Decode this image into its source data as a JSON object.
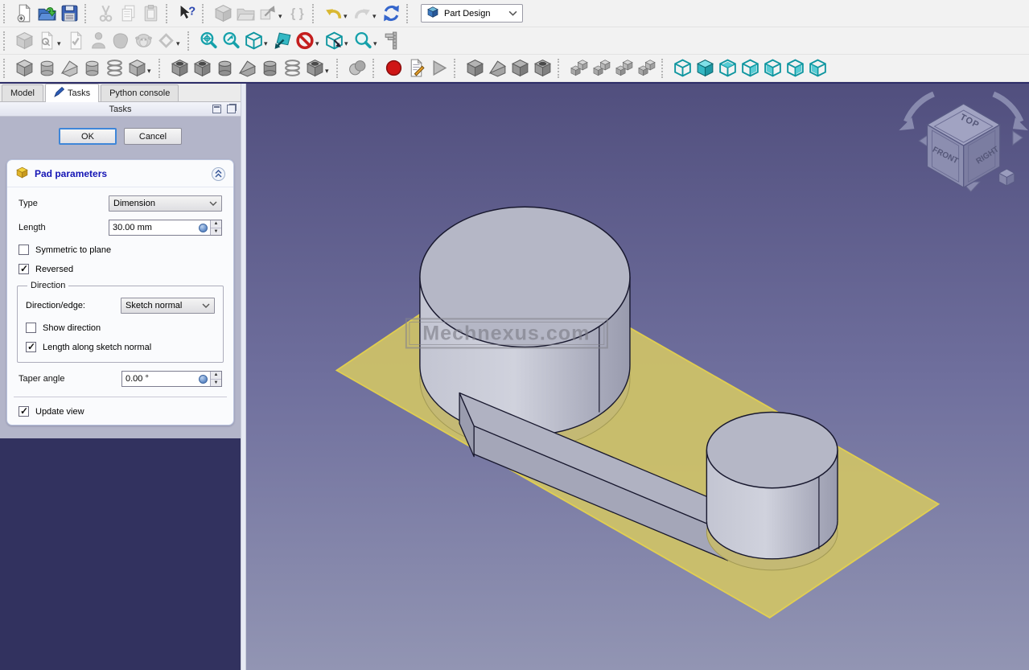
{
  "workbench_selector": {
    "value": "Part Design"
  },
  "toolbars": {
    "rows": [
      {
        "name": "row-1",
        "groups": [
          {
            "name": "file",
            "items": [
              {
                "name": "new-file",
                "icon": "page-new"
              },
              {
                "name": "open-file",
                "icon": "folder-open"
              },
              {
                "name": "save-file",
                "icon": "save"
              }
            ]
          },
          {
            "name": "edit",
            "items": [
              {
                "name": "cut",
                "icon": "cut",
                "disabled": true
              },
              {
                "name": "copy",
                "icon": "copy",
                "disabled": true
              },
              {
                "name": "paste",
                "icon": "paste",
                "disabled": true
              }
            ]
          },
          {
            "name": "help",
            "items": [
              {
                "name": "whats-this",
                "icon": "whats-this"
              }
            ]
          },
          {
            "name": "structure",
            "items": [
              {
                "name": "create-part",
                "icon": "part",
                "disabled": true
              },
              {
                "name": "create-group",
                "icon": "folder-gray",
                "disabled": true
              },
              {
                "name": "make-link",
                "icon": "link",
                "disabled": true,
                "dropdown": true
              },
              {
                "name": "create-variable-set",
                "icon": "braces",
                "disabled": true
              }
            ]
          },
          {
            "name": "undo-redo",
            "items": [
              {
                "name": "undo",
                "icon": "undo",
                "dropdown": true
              },
              {
                "name": "redo",
                "icon": "redo",
                "disabled": true,
                "dropdown": true
              },
              {
                "name": "refresh",
                "icon": "refresh"
              }
            ]
          },
          {
            "name": "workbench",
            "items": [
              {
                "name": "workbench-selector",
                "icon": "part-design",
                "combo": true
              }
            ]
          }
        ]
      },
      {
        "name": "row-2",
        "groups": [
          {
            "name": "part-design-helper",
            "items": [
              {
                "name": "create-body",
                "icon": "body",
                "disabled": true
              },
              {
                "name": "create-sketch",
                "icon": "sketch",
                "disabled": true,
                "dropdown": true
              },
              {
                "name": "edit-sketch",
                "icon": "edit-sketch",
                "disabled": true
              },
              {
                "name": "attach-sketch",
                "icon": "person",
                "disabled": true
              },
              {
                "name": "map-sketch",
                "icon": "blob",
                "disabled": true
              },
              {
                "name": "validate-sketch",
                "icon": "sheep",
                "disabled": true
              },
              {
                "name": "create-datum",
                "icon": "diamond",
                "disabled": true,
                "dropdown": true
              }
            ]
          },
          {
            "name": "view",
            "items": [
              {
                "name": "fit-all",
                "icon": "mag-plus"
              },
              {
                "name": "fit-selection",
                "icon": "mag-arrow"
              },
              {
                "name": "axonometric-view",
                "icon": "cube-wire",
                "dropdown": true
              },
              {
                "name": "align-to-selection",
                "icon": "plane-arrow"
              },
              {
                "name": "clipping-plane",
                "icon": "no-sign",
                "dropdown": true
              },
              {
                "name": "view-rotate",
                "icon": "cube-arrow",
                "dropdown": true
              },
              {
                "name": "zoom",
                "icon": "mag",
                "dropdown": true
              },
              {
                "name": "measure",
                "icon": "caliper"
              }
            ]
          }
        ]
      },
      {
        "name": "row-3",
        "groups": [
          {
            "name": "additive",
            "items": [
              {
                "name": "pad",
                "icon": "solid"
              },
              {
                "name": "revolution",
                "icon": "cyl"
              },
              {
                "name": "additive-loft",
                "icon": "wedge"
              },
              {
                "name": "additive-pipe",
                "icon": "cyl"
              },
              {
                "name": "additive-helix",
                "icon": "helix"
              },
              {
                "name": "additive-primitive",
                "icon": "solid",
                "dropdown": true
              }
            ]
          },
          {
            "name": "subtractive",
            "items": [
              {
                "name": "pocket",
                "icon": "hole-box"
              },
              {
                "name": "hole",
                "icon": "hole-box"
              },
              {
                "name": "groove",
                "icon": "cyl-dark"
              },
              {
                "name": "subtractive-loft",
                "icon": "wedge-dark"
              },
              {
                "name": "subtractive-pipe",
                "icon": "cyl-dark"
              },
              {
                "name": "subtractive-helix",
                "icon": "helix"
              },
              {
                "name": "subtractive-primitive",
                "icon": "hole-box",
                "dropdown": true
              }
            ]
          },
          {
            "name": "boolean",
            "items": [
              {
                "name": "boolean-operation",
                "icon": "spheres"
              }
            ]
          },
          {
            "name": "macro",
            "items": [
              {
                "name": "macro-record",
                "icon": "record"
              },
              {
                "name": "macros-dialog",
                "icon": "macro-doc"
              },
              {
                "name": "execute-macro",
                "icon": "play"
              }
            ]
          },
          {
            "name": "dress-up",
            "items": [
              {
                "name": "fillet",
                "icon": "solid-dark"
              },
              {
                "name": "chamfer",
                "icon": "wedge-dark"
              },
              {
                "name": "draft",
                "icon": "solid-dark"
              },
              {
                "name": "thickness",
                "icon": "hole-box"
              }
            ]
          },
          {
            "name": "transform",
            "items": [
              {
                "name": "linear-pattern",
                "icon": "pattern"
              },
              {
                "name": "mirrored-pattern",
                "icon": "pattern"
              },
              {
                "name": "polar-pattern",
                "icon": "pattern"
              },
              {
                "name": "multi-transform",
                "icon": "pattern"
              }
            ]
          },
          {
            "name": "std-views",
            "items": [
              {
                "name": "view-axonometric",
                "icon": "cube-wire"
              },
              {
                "name": "view-front",
                "icon": "cube-solid"
              },
              {
                "name": "view-top",
                "icon": "cube-face-top"
              },
              {
                "name": "view-right",
                "icon": "cube-face-right"
              },
              {
                "name": "view-rear",
                "icon": "cube-face-left"
              },
              {
                "name": "view-bottom",
                "icon": "cube-face-right"
              },
              {
                "name": "view-left",
                "icon": "cube-face-left"
              }
            ]
          }
        ]
      }
    ]
  },
  "left_panel": {
    "tabs": [
      {
        "label": "Model",
        "active": false
      },
      {
        "label": "Tasks",
        "active": true
      },
      {
        "label": "Python console",
        "active": false
      }
    ],
    "title": "Tasks",
    "actions": {
      "ok": "OK",
      "cancel": "Cancel"
    },
    "pad_parameters": {
      "title": "Pad parameters",
      "type_label": "Type",
      "type_value": "Dimension",
      "length_label": "Length",
      "length_value": "30.00 mm",
      "symmetric_label": "Symmetric to plane",
      "symmetric_checked": false,
      "reversed_label": "Reversed",
      "reversed_checked": true,
      "direction_group": {
        "title": "Direction",
        "direction_edge_label": "Direction/edge:",
        "direction_edge_value": "Sketch normal",
        "show_direction_label": "Show direction",
        "show_direction_checked": false,
        "length_along_label": "Length along sketch normal",
        "length_along_checked": true
      },
      "taper_label": "Taper angle",
      "taper_value": "0.00 °",
      "update_view_label": "Update view",
      "update_view_checked": true
    }
  },
  "viewport": {
    "watermark": "Mechnexus.com",
    "nav_cube": {
      "faces": [
        "TOP",
        "FRONT",
        "RIGHT"
      ]
    },
    "colors": {
      "bg_top": "#514f7e",
      "bg_bottom": "#9295b3",
      "plane": "#cfc368",
      "plane_edge": "#e9d54b",
      "solid_top": "#b5b7c6",
      "solid_side": "#c6c8d3",
      "under_plane": "#c4b974",
      "edge": "#18182e"
    }
  }
}
